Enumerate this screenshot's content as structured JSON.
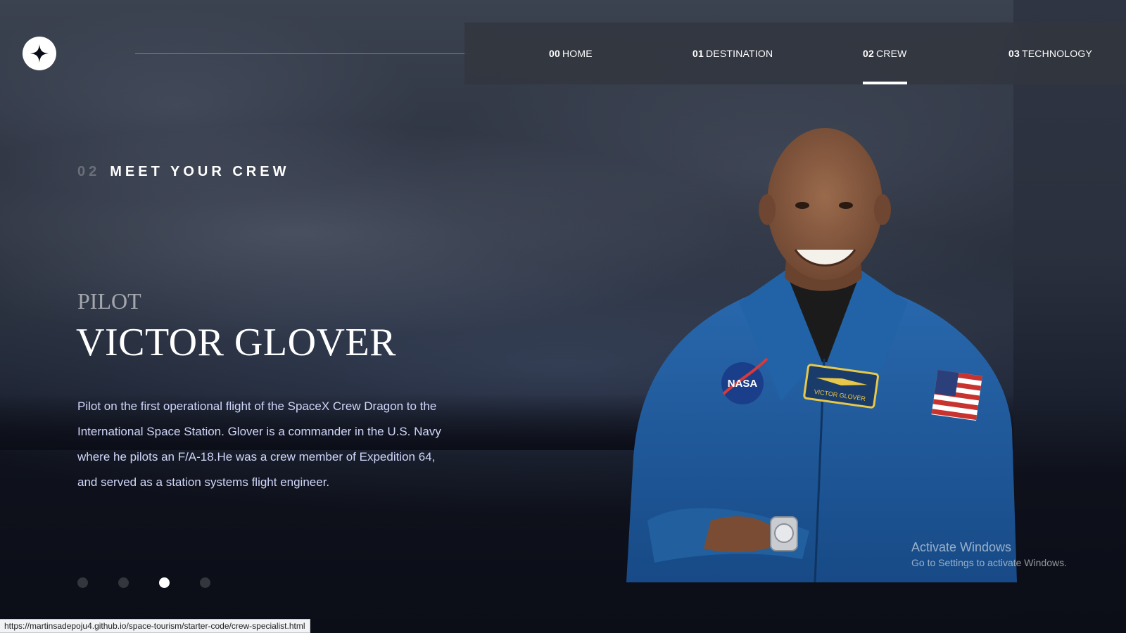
{
  "header": {
    "logo_icon": "four-point-star-icon",
    "nav": [
      {
        "num": "00",
        "label": "HOME",
        "active": false
      },
      {
        "num": "01",
        "label": "DESTINATION",
        "active": false
      },
      {
        "num": "02",
        "label": "CREW",
        "active": true
      },
      {
        "num": "03",
        "label": "TECHNOLOGY",
        "active": false
      }
    ]
  },
  "main": {
    "heading_num": "02",
    "heading_text": "MEET YOUR CREW",
    "role": "PILOT",
    "name": "VICTOR GLOVER",
    "bio": "Pilot on the first operational flight of the SpaceX Crew Dragon to the International Space Station. Glover is a commander in the U.S. Navy where he pilots an F/A-18.He was a crew member of Expedition 64, and served as a station systems flight engineer.",
    "pagination": {
      "count": 4,
      "active_index": 2
    },
    "crew_image": {
      "patch_text": "VICTOR GLOVER",
      "agency_logo": "NASA"
    }
  },
  "overlay": {
    "activate_title": "Activate Windows",
    "activate_subtitle": "Go to Settings to activate Windows."
  },
  "status_bar": {
    "url": "https://martinsadepoju4.github.io/space-tourism/starter-code/crew-specialist.html"
  },
  "colors": {
    "background": "#0b0d17",
    "text_light": "#d0d6f9",
    "accent": "#ffffff",
    "suit_blue": "#1f5a9c"
  }
}
